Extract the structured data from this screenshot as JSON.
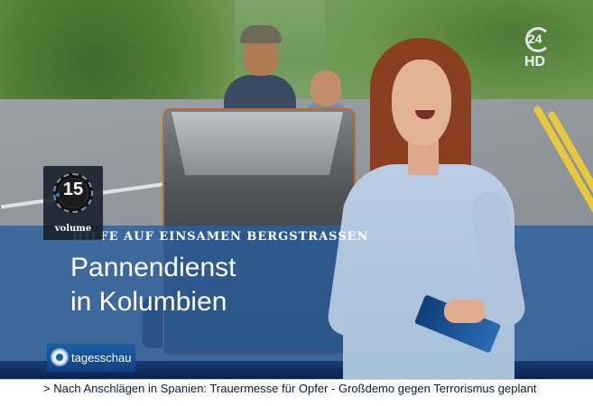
{
  "volume": {
    "value": "15",
    "label": "volume"
  },
  "channel": {
    "number": "24",
    "quality": "HD"
  },
  "lower_third": {
    "topline": "HILFE AUF EINSAMEN BERGSTRASSEN",
    "headline_line1": "Pannendienst",
    "headline_line2": "in Kolumbien"
  },
  "logo": {
    "name": "tagesschau"
  },
  "ticker": {
    "text": "> Nach Anschlägen in Spanien: Trauermesse für Opfer - Großdemo gegen Terrorismus geplant"
  },
  "colors": {
    "band": "#2c5f9e",
    "logo_blue": "#1b5fa7",
    "ticker_bg": "#ffffff"
  }
}
